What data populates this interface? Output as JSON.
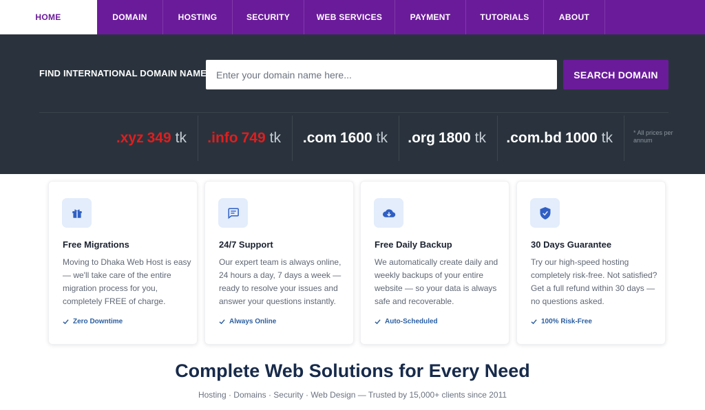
{
  "nav": {
    "items": [
      {
        "label": "HOME",
        "active": true
      },
      {
        "label": "DOMAIN",
        "active": false
      },
      {
        "label": "HOSTING",
        "active": false
      },
      {
        "label": "SECURITY",
        "active": false
      },
      {
        "label": "WEB SERVICES",
        "active": false
      },
      {
        "label": "PAYMENT",
        "active": false
      },
      {
        "label": "TUTORIALS",
        "active": false
      },
      {
        "label": "ABOUT",
        "active": false
      }
    ]
  },
  "search": {
    "label": "FIND INTERNATIONAL DOMAIN NAME:",
    "placeholder": "Enter your domain name here...",
    "value": "",
    "button_label": "SEARCH DOMAIN"
  },
  "prices": [
    {
      "ext": ".xyz",
      "amount": "349",
      "unit": "tk",
      "highlight": true
    },
    {
      "ext": ".info",
      "amount": "749",
      "unit": "tk",
      "highlight": true
    },
    {
      "ext": ".com",
      "amount": "1600",
      "unit": "tk",
      "highlight": false
    },
    {
      "ext": ".org",
      "amount": "1800",
      "unit": "tk",
      "highlight": false
    },
    {
      "ext": ".com.bd",
      "amount": "1000",
      "unit": "tk",
      "highlight": false
    }
  ],
  "price_note": "* All prices per annum",
  "features": [
    {
      "icon": "gift-icon",
      "title": "Free Migrations",
      "text": "Moving to Dhaka Web Host is easy — we'll take care of the entire migration process for you, completely FREE of charge.",
      "tag": "Zero Downtime"
    },
    {
      "icon": "chat-icon",
      "title": "24/7 Support",
      "text": "Our expert team is always online, 24 hours a day, 7 days a week — ready to resolve your issues and answer your questions instantly.",
      "tag": "Always Online"
    },
    {
      "icon": "cloud-download-icon",
      "title": "Free Daily Backup",
      "text": "We automatically create daily and weekly backups of your entire website — so your data is always safe and recoverable.",
      "tag": "Auto-Scheduled"
    },
    {
      "icon": "shield-check-icon",
      "title": "30 Days Guarantee",
      "text": "Try our high-speed hosting completely risk-free. Not satisfied? Get a full refund within 30 days — no questions asked.",
      "tag": "100% Risk-Free"
    }
  ],
  "headline": {
    "title": "Complete Web Solutions for Every Need",
    "subtitle": "Hosting · Domains · Security · Web Design — Trusted by 15,000+ clients since 2011"
  },
  "colors": {
    "brand_purple": "#6a1b9a",
    "band_dark": "#2a333d",
    "price_red": "#e11d1d",
    "icon_blue": "#2f5fc4",
    "icon_bg": "#e3edfb",
    "headline_navy": "#172a4a"
  }
}
